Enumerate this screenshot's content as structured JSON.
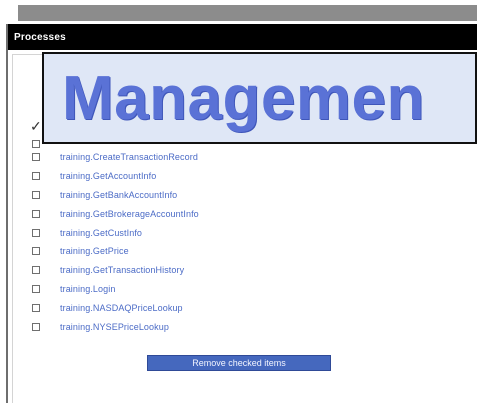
{
  "window": {
    "title": "Processes"
  },
  "overlay": {
    "text": "Managemen"
  },
  "process_list": {
    "items": [
      {
        "label": "training.CreateTransactionRecord",
        "checked": false
      },
      {
        "label": "training.GetAccountInfo",
        "checked": false
      },
      {
        "label": "training.GetBankAccountInfo",
        "checked": false
      },
      {
        "label": "training.GetBrokerageAccountInfo",
        "checked": false
      },
      {
        "label": "training.GetCustInfo",
        "checked": false
      },
      {
        "label": "training.GetPrice",
        "checked": false
      },
      {
        "label": "training.GetTransactionHistory",
        "checked": false
      },
      {
        "label": "training.Login",
        "checked": false
      },
      {
        "label": "training.NASDAQPriceLookup",
        "checked": false
      },
      {
        "label": "training.NYSEPriceLookup",
        "checked": false
      }
    ]
  },
  "actions": {
    "remove_checked_label": "Remove checked items"
  },
  "colors": {
    "title_bar": "#000000",
    "link_text": "#4b6bc6",
    "overlay_background": "#dfe7f6",
    "overlay_text": "#5a72d6",
    "button_background": "#4568be"
  }
}
